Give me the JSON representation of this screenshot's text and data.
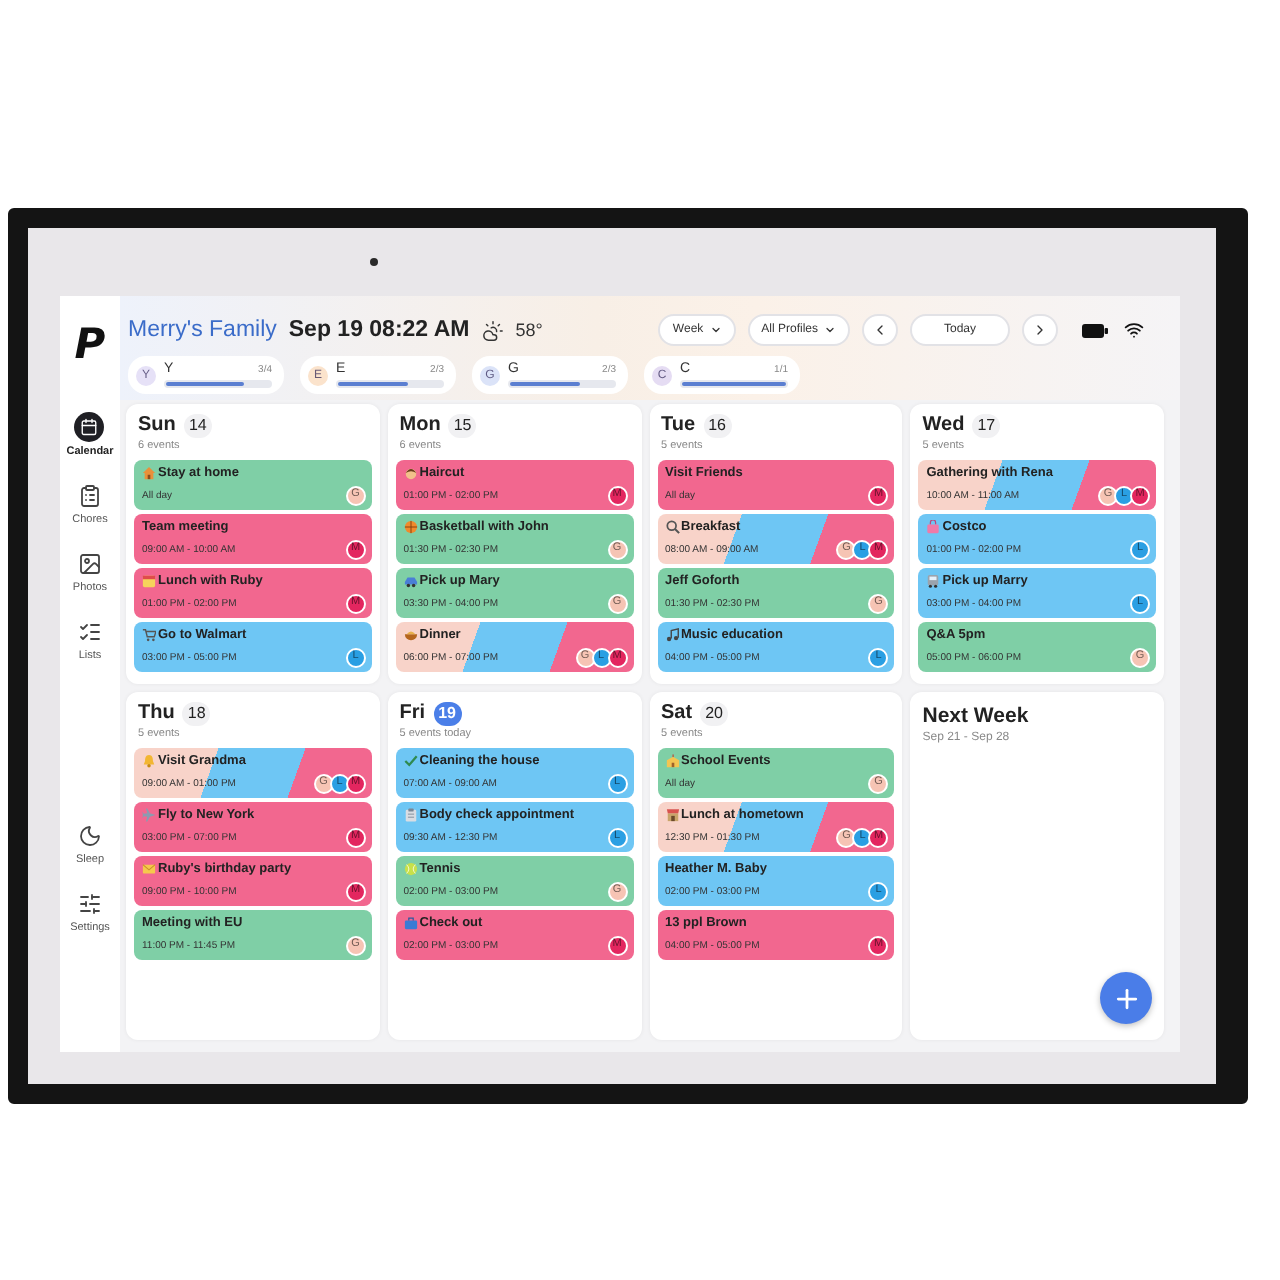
{
  "sidebar": {
    "logo": "P",
    "items": [
      {
        "label": "Calendar",
        "selected": true
      },
      {
        "label": "Chores",
        "selected": false
      },
      {
        "label": "Photos",
        "selected": false
      },
      {
        "label": "Lists",
        "selected": false
      }
    ],
    "bottom_items": [
      {
        "label": "Sleep",
        "selected": false
      },
      {
        "label": "Settings",
        "selected": false
      }
    ]
  },
  "header": {
    "title": "Merry's Family",
    "datetime": "Sep 19 08:22 AM",
    "weather": "58°",
    "view_select": "Week",
    "profile_select": "All Profiles",
    "today_button": "Today"
  },
  "profiles": [
    {
      "initial": "Y",
      "name": "Y",
      "count": "3/4",
      "level": 0.75,
      "color": "#e6e1f7"
    },
    {
      "initial": "E",
      "name": "E",
      "count": "2/3",
      "level": 0.67,
      "color": "#fbe3cc"
    },
    {
      "initial": "G",
      "name": "G",
      "count": "2/3",
      "level": 0.67,
      "color": "#dbe3f8"
    },
    {
      "initial": "C",
      "name": "C",
      "count": "1/1",
      "level": 1,
      "color": "#e5dcf3"
    }
  ],
  "days": [
    {
      "name": "Sun",
      "number": "14",
      "today": false,
      "count": "6 events",
      "events": [
        {
          "title": "Stay at home",
          "time": "All day",
          "icon": true,
          "stripes": [
            {
              "color": "#7fcfa6"
            }
          ],
          "avatars": [
            {
              "letter": "G",
              "color": "#f6c4b4"
            }
          ]
        },
        {
          "title": "Team meeting",
          "time": "09:00 AM - 10:00 AM",
          "icon": false,
          "stripes": [
            {
              "color": "#f2678f"
            }
          ],
          "avatars": [
            {
              "letter": "M",
              "color": "#e3265f"
            }
          ]
        },
        {
          "title": "Lunch with Ruby",
          "time": "01:00 PM - 02:00 PM",
          "icon": true,
          "stripes": [
            {
              "color": "#f2678f"
            }
          ],
          "avatars": [
            {
              "letter": "M",
              "color": "#e3265f"
            }
          ]
        },
        {
          "title": "Go to Walmart",
          "time": "03:00 PM - 05:00 PM",
          "icon": true,
          "stripes": [
            {
              "color": "#6ec6f4"
            }
          ],
          "avatars": [
            {
              "letter": "L",
              "color": "#2a9fe3"
            }
          ]
        }
      ]
    },
    {
      "name": "Mon",
      "number": "15",
      "today": false,
      "count": "6 events",
      "events": [
        {
          "title": "Haircut",
          "time": "01:00 PM - 02:00 PM",
          "icon": true,
          "stripes": [
            {
              "color": "#f2678f"
            }
          ],
          "avatars": [
            {
              "letter": "M",
              "color": "#e3265f"
            }
          ]
        },
        {
          "title": "Basketball with John",
          "time": "01:30 PM - 02:30 PM",
          "icon": true,
          "stripes": [
            {
              "color": "#7fcfa6"
            }
          ],
          "avatars": [
            {
              "letter": "G",
              "color": "#f6c4b4"
            }
          ]
        },
        {
          "title": "Pick up Mary",
          "time": "03:30 PM - 04:00 PM",
          "icon": true,
          "stripes": [
            {
              "color": "#7fcfa6"
            }
          ],
          "avatars": [
            {
              "letter": "G",
              "color": "#f6c4b4"
            }
          ]
        },
        {
          "title": "Dinner",
          "time": "06:00 PM - 07:00 PM",
          "icon": true,
          "stripes": [
            {
              "color": "#f8d3c9"
            },
            {
              "color": "#6ec6f4"
            },
            {
              "color": "#f2678f"
            }
          ],
          "avatars": [
            {
              "letter": "G",
              "color": "#f6c4b4"
            },
            {
              "letter": "L",
              "color": "#2a9fe3"
            },
            {
              "letter": "M",
              "color": "#e3265f"
            }
          ]
        }
      ]
    },
    {
      "name": "Tue",
      "number": "16",
      "today": false,
      "count": "5 events",
      "events": [
        {
          "title": "Visit Friends",
          "time": "All day",
          "icon": false,
          "stripes": [
            {
              "color": "#f2678f"
            }
          ],
          "avatars": [
            {
              "letter": "M",
              "color": "#e3265f"
            }
          ]
        },
        {
          "title": "Breakfast",
          "time": "08:00 AM - 09:00 AM",
          "icon": true,
          "stripes": [
            {
              "color": "#f8d3c9"
            },
            {
              "color": "#6ec6f4"
            },
            {
              "color": "#f2678f"
            }
          ],
          "avatars": [
            {
              "letter": "G",
              "color": "#f6c4b4"
            },
            {
              "letter": "L",
              "color": "#2a9fe3"
            },
            {
              "letter": "M",
              "color": "#e3265f"
            }
          ]
        },
        {
          "title": "Jeff Goforth",
          "time": "01:30 PM - 02:30 PM",
          "icon": false,
          "stripes": [
            {
              "color": "#7fcfa6"
            }
          ],
          "avatars": [
            {
              "letter": "G",
              "color": "#f6c4b4"
            }
          ]
        },
        {
          "title": "Music education",
          "time": "04:00 PM - 05:00 PM",
          "icon": true,
          "stripes": [
            {
              "color": "#6ec6f4"
            }
          ],
          "avatars": [
            {
              "letter": "L",
              "color": "#2a9fe3"
            }
          ]
        }
      ]
    },
    {
      "name": "Wed",
      "number": "17",
      "today": false,
      "count": "5 events",
      "events": [
        {
          "title": "Gathering with Rena",
          "time": "10:00 AM - 11:00 AM",
          "icon": false,
          "stripes": [
            {
              "color": "#f8d3c9"
            },
            {
              "color": "#6ec6f4"
            },
            {
              "color": "#f2678f"
            }
          ],
          "avatars": [
            {
              "letter": "G",
              "color": "#f6c4b4"
            },
            {
              "letter": "L",
              "color": "#2a9fe3"
            },
            {
              "letter": "M",
              "color": "#e3265f"
            }
          ]
        },
        {
          "title": "Costco",
          "time": "01:00 PM - 02:00 PM",
          "icon": true,
          "stripes": [
            {
              "color": "#6ec6f4"
            }
          ],
          "avatars": [
            {
              "letter": "L",
              "color": "#2a9fe3"
            }
          ]
        },
        {
          "title": "Pick up Marry",
          "time": "03:00 PM - 04:00 PM",
          "icon": true,
          "stripes": [
            {
              "color": "#6ec6f4"
            }
          ],
          "avatars": [
            {
              "letter": "L",
              "color": "#2a9fe3"
            }
          ]
        },
        {
          "title": "Q&A 5pm",
          "time": "05:00 PM - 06:00 PM",
          "icon": false,
          "stripes": [
            {
              "color": "#7fcfa6"
            }
          ],
          "avatars": [
            {
              "letter": "G",
              "color": "#f6c4b4"
            }
          ]
        }
      ]
    },
    {
      "name": "Thu",
      "number": "18",
      "today": false,
      "count": "5 events",
      "events": [
        {
          "title": "Visit Grandma",
          "time": "09:00 AM - 01:00 PM",
          "icon": true,
          "stripes": [
            {
              "color": "#f8d3c9"
            },
            {
              "color": "#6ec6f4"
            },
            {
              "color": "#f2678f"
            }
          ],
          "avatars": [
            {
              "letter": "G",
              "color": "#f6c4b4"
            },
            {
              "letter": "L",
              "color": "#2a9fe3"
            },
            {
              "letter": "M",
              "color": "#e3265f"
            }
          ]
        },
        {
          "title": "Fly to New York",
          "time": "03:00 PM - 07:00 PM",
          "icon": true,
          "stripes": [
            {
              "color": "#f2678f"
            }
          ],
          "avatars": [
            {
              "letter": "M",
              "color": "#e3265f"
            }
          ]
        },
        {
          "title": "Ruby's birthday party",
          "time": "09:00 PM - 10:00 PM",
          "icon": true,
          "stripes": [
            {
              "color": "#f2678f"
            }
          ],
          "avatars": [
            {
              "letter": "M",
              "color": "#e3265f"
            }
          ]
        },
        {
          "title": "Meeting with EU",
          "time": "11:00 PM - 11:45 PM",
          "icon": false,
          "stripes": [
            {
              "color": "#7fcfa6"
            }
          ],
          "avatars": [
            {
              "letter": "G",
              "color": "#f6c4b4"
            }
          ]
        }
      ]
    },
    {
      "name": "Fri",
      "number": "19",
      "today": true,
      "count": "5 events today",
      "events": [
        {
          "title": "Cleaning the house",
          "time": "07:00 AM - 09:00 AM",
          "icon": true,
          "stripes": [
            {
              "color": "#6ec6f4"
            }
          ],
          "avatars": [
            {
              "letter": "L",
              "color": "#2a9fe3"
            }
          ]
        },
        {
          "title": "Body check appointment",
          "time": "09:30 AM - 12:30 PM",
          "icon": true,
          "stripes": [
            {
              "color": "#6ec6f4"
            }
          ],
          "avatars": [
            {
              "letter": "L",
              "color": "#2a9fe3"
            }
          ]
        },
        {
          "title": "Tennis",
          "time": "02:00 PM - 03:00 PM",
          "icon": true,
          "stripes": [
            {
              "color": "#7fcfa6"
            }
          ],
          "avatars": [
            {
              "letter": "G",
              "color": "#f6c4b4"
            }
          ]
        },
        {
          "title": "Check out",
          "time": "02:00 PM - 03:00 PM",
          "icon": true,
          "stripes": [
            {
              "color": "#f2678f"
            }
          ],
          "avatars": [
            {
              "letter": "M",
              "color": "#e3265f"
            }
          ]
        }
      ]
    },
    {
      "name": "Sat",
      "number": "20",
      "today": false,
      "count": "5 events",
      "events": [
        {
          "title": "School Events",
          "time": "All day",
          "icon": true,
          "stripes": [
            {
              "color": "#7fcfa6"
            }
          ],
          "avatars": [
            {
              "letter": "G",
              "color": "#f6c4b4"
            }
          ]
        },
        {
          "title": "Lunch at hometown",
          "time": "12:30 PM - 01:30 PM",
          "icon": true,
          "stripes": [
            {
              "color": "#f8d3c9"
            },
            {
              "color": "#6ec6f4"
            },
            {
              "color": "#f2678f"
            }
          ],
          "avatars": [
            {
              "letter": "G",
              "color": "#f6c4b4"
            },
            {
              "letter": "L",
              "color": "#2a9fe3"
            },
            {
              "letter": "M",
              "color": "#e3265f"
            }
          ]
        },
        {
          "title": "Heather M. Baby",
          "time": "02:00 PM - 03:00 PM",
          "icon": false,
          "stripes": [
            {
              "color": "#6ec6f4"
            }
          ],
          "avatars": [
            {
              "letter": "L",
              "color": "#2a9fe3"
            }
          ]
        },
        {
          "title": "13 ppl Brown",
          "time": "04:00 PM - 05:00 PM",
          "icon": false,
          "stripes": [
            {
              "color": "#f2678f"
            }
          ],
          "avatars": [
            {
              "letter": "M",
              "color": "#e3265f"
            }
          ]
        }
      ]
    }
  ],
  "next_week": {
    "title": "Next Week",
    "range": "Sep 21 - Sep 28"
  }
}
